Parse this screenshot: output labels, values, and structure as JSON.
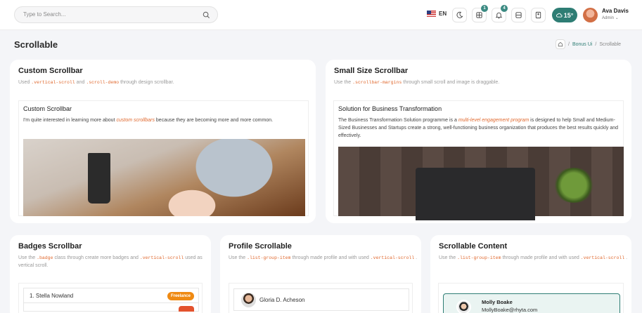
{
  "header": {
    "search_placeholder": "Type to Search...",
    "language": "EN",
    "apps_badge": "1",
    "notifications_badge": "4",
    "weather_temp": "15°",
    "user_name": "Ava Davis",
    "user_role": "Admin"
  },
  "page": {
    "title": "Scrollable",
    "breadcrumb": [
      "Bonus Ui",
      "Scrollable"
    ]
  },
  "cards": {
    "custom": {
      "title": "Custom Scrollbar",
      "desc_pre": "Used",
      "code1": ".vertical-scroll",
      "desc_mid": "and",
      "code2": ".scroll-demo",
      "desc_post": "through design scrollbar.",
      "inner_title": "Custom Scrollbar",
      "inner_text_pre": "I'm quite interested in learning more about",
      "inner_text_em": "custom scrollbars",
      "inner_text_post": "because they are becoming more and more common."
    },
    "small": {
      "title": "Small Size Scrollbar",
      "desc_pre": "Use the",
      "code1": ".scrollbar-margins",
      "desc_post": "through small scroll and image is draggable.",
      "inner_title": "Solution for Business Transformation",
      "inner_text_pre": "The Business Transformation Solution programme is a",
      "inner_text_em": "multi-level engagement program",
      "inner_text_post": "is designed to help Small and Medium-Sized Businesses and Startups create a strong, well-functioning business organization that produces the best results quickly and effectively."
    },
    "badges": {
      "title": "Badges Scrollbar",
      "desc_pre": "Use the",
      "code1": ".badge",
      "desc_mid": "class through create more badges and",
      "code2": ".vertical-scroll",
      "desc_post": "used as vertical scroll.",
      "item_name": "1.  Stella Nowland",
      "item_badge": "Freelance"
    },
    "profile": {
      "title": "Profile Scrollable",
      "desc_pre": "Use the",
      "code1": ".list-group-item",
      "desc_mid": "through made profile and with used",
      "code2": ".vertical-scroll",
      "desc_post": ".",
      "item_name": "Gloria D. Acheson"
    },
    "content": {
      "title": "Scrollable Content",
      "desc_pre": "Use the",
      "code1": ".list-group-item",
      "desc_mid": "through made profile and with used",
      "code2": ".vertical-scroll",
      "desc_post": ".",
      "item_name": "Molly Boake",
      "item_email": "MollyBoake@rhyta.com"
    }
  },
  "colors": {
    "accent": "#2e7d74",
    "code": "#e0692f",
    "badge_orange": "#ef8a12"
  }
}
